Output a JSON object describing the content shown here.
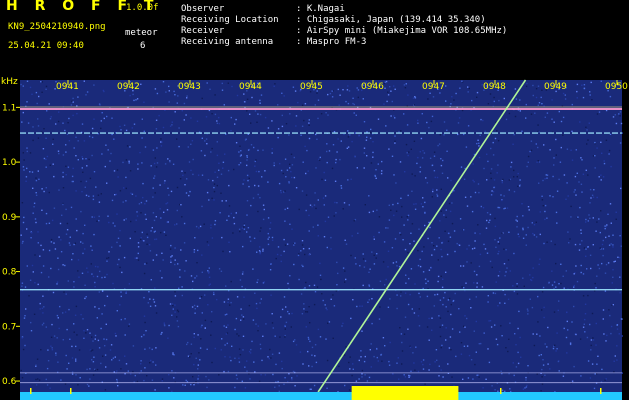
{
  "header": {
    "brand": "H R O F F T",
    "version": "1.0.0f",
    "filename": "KN9_2504210940.png",
    "meteor_label": "meteor",
    "meteor_count": "6",
    "datetime": "25.04.21 09:40",
    "fields": [
      {
        "label": "Observer",
        "value": ": K.Nagai"
      },
      {
        "label": "Receiving Location",
        "value": ": Chigasaki, Japan (139.414 35.340)"
      },
      {
        "label": "Receiver",
        "value": ": AirSpy mini (Miakejima VOR 108.65MHz)"
      },
      {
        "label": "Receiving antenna",
        "value": ": Maspro FM-3"
      }
    ]
  },
  "chart_data": {
    "type": "spectrogram",
    "ylabel": "kHz",
    "x_ticks": [
      "0941",
      "0942",
      "0943",
      "0944",
      "0945",
      "0946",
      "0947",
      "0948",
      "0949",
      "0950"
    ],
    "y_ticks": [
      "1.1",
      "1.0",
      "0.9",
      "0.8",
      "0.7",
      "0.6"
    ],
    "ylim": [
      0.58,
      1.15
    ],
    "horizontal_signals_khz": [
      1.097,
      1.053,
      0.767
    ],
    "reference_lines_khz": [
      0.615,
      0.597
    ],
    "meteor_trace": {
      "start": {
        "time": "0945.1",
        "khz": 0.58
      },
      "end": {
        "time": "0948.5",
        "khz": 1.15
      }
    },
    "background_color": "#1a2a7a",
    "signal_color": "#9ee8ff"
  }
}
